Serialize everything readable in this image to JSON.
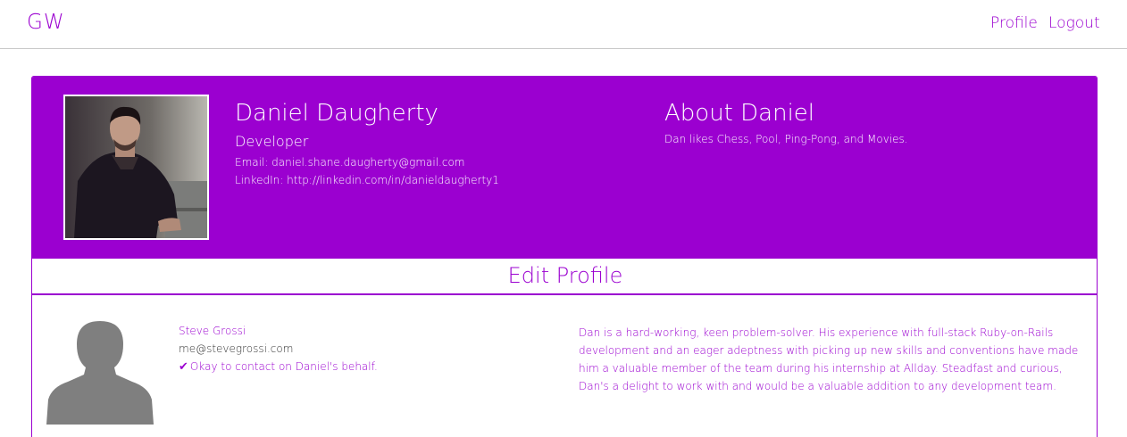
{
  "nav": {
    "brand": "GW",
    "profile_label": "Profile",
    "logout_label": "Logout"
  },
  "profile": {
    "name": "Daniel Daugherty",
    "title": "Developer",
    "email_label": "Email:",
    "email": "daniel.shane.daugherty@gmail.com",
    "linkedin_label": "LinkedIn:",
    "linkedin": "http://linkedin.com/in/danieldaugherty1"
  },
  "about": {
    "heading": "About Daniel",
    "text": "Dan likes Chess, Pool, Ping-Pong, and Movies."
  },
  "edit_profile_label": "Edit Profile",
  "reference": {
    "name": "Steve Grossi",
    "email": "me@stevegrossi.com",
    "ok_to_contact": "Okay to contact on Daniel's behalf.",
    "recommendation": "Dan is a hard-working, keen problem-solver. His experience with full-stack Ruby-on-Rails development and an eager adeptness with picking up new skills and conventions have made him a valuable member of the team during his internship at Allday. Steadfast and curious, Dan's a delight to work with and would be a valuable addition to any development team."
  },
  "colors": {
    "accent": "#9b00d0",
    "hero_text": "#ffffff"
  },
  "icons": [
    "check-icon",
    "default-avatar-icon"
  ]
}
